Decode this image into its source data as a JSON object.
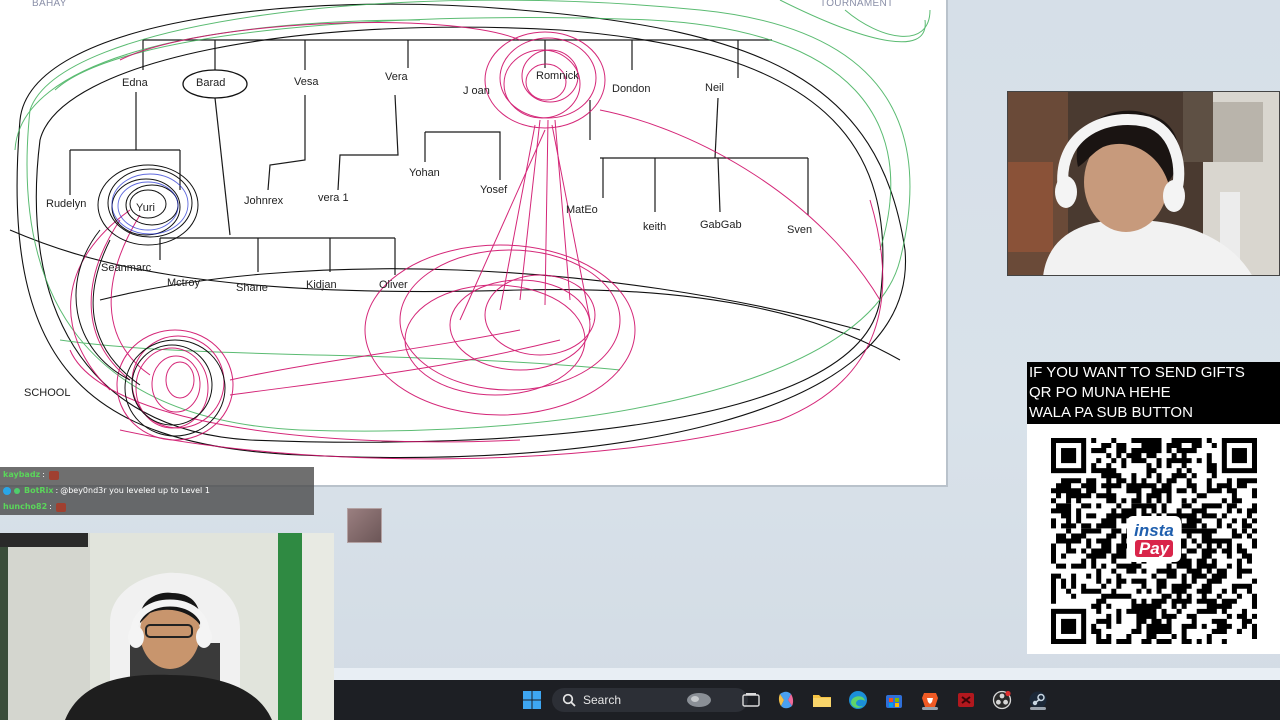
{
  "whiteboard": {
    "corner_labels": {
      "top_left": "BAHAY",
      "top_right": "TOURNAMENT",
      "bottom_left": "SCHOOL"
    },
    "names": {
      "edna": "Edna",
      "barad": "Barad",
      "vesa": "Vesa",
      "vera": "Vera",
      "joan": "J oan",
      "romnick": "Romnick",
      "dondon": "Dondon",
      "neil": "Neil",
      "rudelyn": "Rudelyn",
      "yuri": "Yuri",
      "johnrex": "Johnrex",
      "vera1": "vera 1",
      "yohan": "Yohan",
      "yosef": "Yosef",
      "mateo": "MatEo",
      "keith": "keith",
      "gabgab": "GabGab",
      "sven": "Sven",
      "seanmarc": "Seanmarc",
      "mctroy": "Mctroy",
      "shane": "Shane",
      "kidjan": "Kidjan",
      "oliver": "Oliver"
    }
  },
  "chat": {
    "messages": [
      {
        "user": "kaybadz",
        "sep": " :",
        "text": "",
        "user_color": "#5ad65a"
      },
      {
        "user": "BotRix",
        "sep": " :",
        "text": "@bey0nd3r you leveled up to Level 1",
        "user_color": "#5ad65a"
      },
      {
        "user": "huncho82",
        "sep": " :",
        "text": "",
        "user_color": "#5ad65a"
      }
    ]
  },
  "gift_box": {
    "line1": "IF YOU WANT TO SEND GIFTS",
    "line2": "QR PO MUNA HEHE",
    "line3": "WALA PA SUB BUTTON",
    "logo_top": "insta",
    "logo_bottom": "Pay"
  },
  "taskbar": {
    "search_label": "Search",
    "icons": [
      "windows-start-icon",
      "search-icon",
      "task-view-icon",
      "copilot-icon",
      "file-explorer-icon",
      "edge-icon",
      "store-icon",
      "brave-icon",
      "app-red-icon",
      "obs-icon",
      "steam-icon"
    ]
  },
  "colors": {
    "desktop_bg": "#d6dfe8",
    "taskbar_bg": "#1d1f24",
    "scribble_magenta": "#d0106a",
    "scribble_green": "#3fb05a",
    "scribble_black": "#111111"
  }
}
